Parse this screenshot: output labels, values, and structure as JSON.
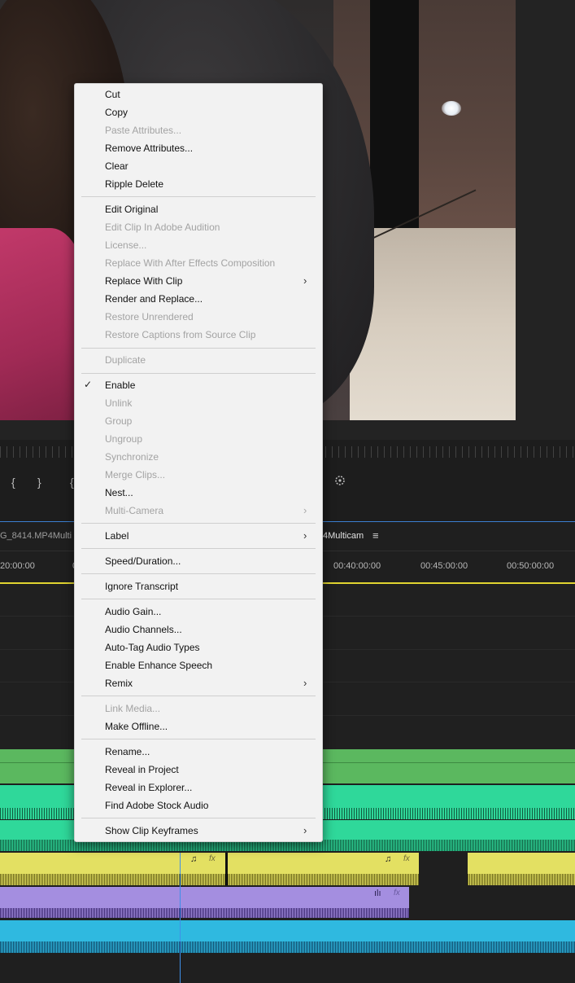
{
  "context_menu": {
    "cut": "Cut",
    "copy": "Copy",
    "paste_attributes": "Paste Attributes...",
    "remove_attributes": "Remove Attributes...",
    "clear": "Clear",
    "ripple_delete": "Ripple Delete",
    "edit_original": "Edit Original",
    "edit_in_audition": "Edit Clip In Adobe Audition",
    "license": "License...",
    "replace_ae": "Replace With After Effects Composition",
    "replace_clip": "Replace With Clip",
    "render_replace": "Render and Replace...",
    "restore_unrendered": "Restore Unrendered",
    "restore_captions": "Restore Captions from Source Clip",
    "duplicate": "Duplicate",
    "enable": "Enable",
    "unlink": "Unlink",
    "group": "Group",
    "ungroup": "Ungroup",
    "synchronize": "Synchronize",
    "merge_clips": "Merge Clips...",
    "nest": "Nest...",
    "multi_camera": "Multi-Camera",
    "label": "Label",
    "speed_duration": "Speed/Duration...",
    "ignore_transcript": "Ignore Transcript",
    "audio_gain": "Audio Gain...",
    "audio_channels": "Audio Channels...",
    "auto_tag": "Auto-Tag Audio Types",
    "enhance_speech": "Enable Enhance Speech",
    "remix": "Remix",
    "link_media": "Link Media...",
    "make_offline": "Make Offline...",
    "rename": "Rename...",
    "reveal_project": "Reveal in Project",
    "reveal_explorer": "Reveal in Explorer...",
    "find_stock_audio": "Find Adobe Stock Audio",
    "show_keyframes": "Show Clip Keyframes"
  },
  "monitor": {
    "mark_in": "{",
    "mark_out": "}",
    "brace_partial": "{"
  },
  "timeline": {
    "tab_left": "G_8414.MP4Multi",
    "tab_right": "4Multicam",
    "menu_glyph": "≡",
    "timecodes": [
      "20:00:00",
      "0",
      "00:40:00:00",
      "00:45:00:00",
      "00:50:00:00"
    ]
  },
  "colors": {
    "video_track": "#5bb85f",
    "audio_teal": "#2fd89a",
    "audio_yellow": "#e3e062",
    "audio_purple": "#a48ee0",
    "audio_blue": "#2fb9e0",
    "playhead": "#3f8fe8"
  }
}
